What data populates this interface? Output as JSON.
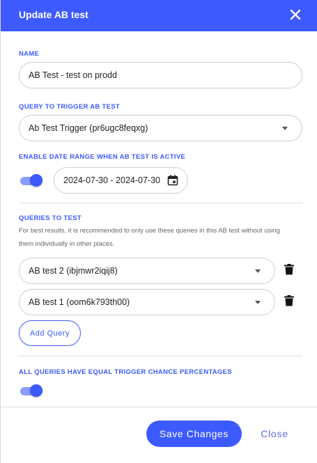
{
  "header": {
    "title": "Update AB test",
    "close_icon": "close-icon"
  },
  "name_field": {
    "label": "NAME",
    "value": "AB Test - test on prodd"
  },
  "trigger_field": {
    "label": "QUERY TO TRIGGER AB TEST",
    "value": "Ab Test Trigger (pr6ugc8feqxg)"
  },
  "date_range": {
    "label": "ENABLE DATE RANGE WHEN AB TEST IS ACTIVE",
    "enabled": true,
    "value": "2024-07-30 - 2024-07-30",
    "icon": "calendar-icon"
  },
  "queries": {
    "label": "QUERIES TO TEST",
    "helper": "For best results, it is recommended to only use these queries in this AB test without using them individually in other places.",
    "items": [
      {
        "value": "AB test 2 (ibjmwr2iqij8)",
        "icon": "trash-icon"
      },
      {
        "value": "AB test 1 (oom6k793th00)",
        "icon": "trash-icon"
      }
    ],
    "add_label": "Add Query"
  },
  "equal_chance": {
    "label": "ALL QUERIES HAVE EQUAL TRIGGER CHANCE PERCENTAGES",
    "enabled": true
  },
  "footer": {
    "save_label": "Save Changes",
    "close_label": "Close"
  },
  "colors": {
    "accent": "#3d5afe",
    "toggle_track": "#8b9cff"
  }
}
